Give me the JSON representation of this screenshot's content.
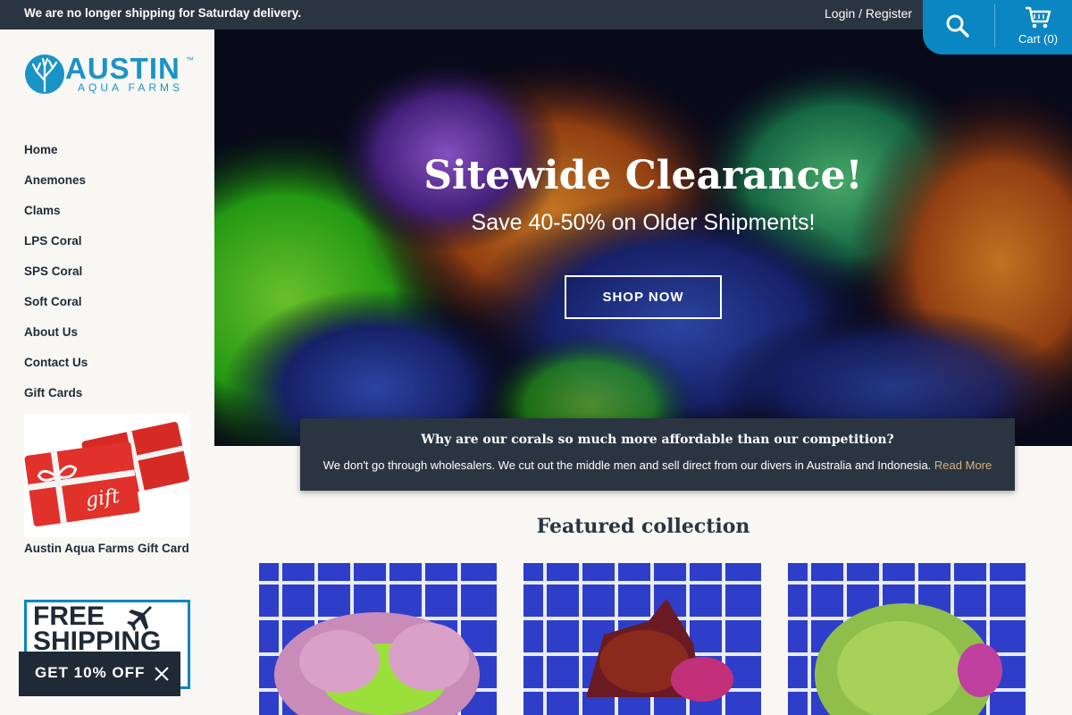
{
  "announcement": "We are no longer shipping for Saturday delivery.",
  "header": {
    "login_label": "Login / Register",
    "cart_label": "Cart (0)",
    "search_icon": "search-icon",
    "cart_icon": "cart-icon"
  },
  "logo": {
    "name": "AUSTIN",
    "subtitle": "AQUA FARMS",
    "tm": "™"
  },
  "nav": {
    "items": [
      "Home",
      "Anemones",
      "Clams",
      "LPS Coral",
      "SPS Coral",
      "Soft Coral",
      "About Us",
      "Contact Us",
      "Gift Cards"
    ]
  },
  "gift_card": {
    "caption": "Austin Aqua Farms Gift Card",
    "image_text": "gift card"
  },
  "free_shipping": {
    "line1": "FREE",
    "line2": "SHIPPING"
  },
  "promo": {
    "label": "GET 10% OFF"
  },
  "hero": {
    "headline": "Sitewide Clearance!",
    "subline": "Save 40-50% on Older Shipments!",
    "cta": "SHOP NOW"
  },
  "callout": {
    "question": "Why are our corals so much more affordable than our competition?",
    "answer": "We don't go through wholesalers. We cut out the middle men and sell direct from our divers in Australia and Indonesia.",
    "link": "Read More"
  },
  "featured": {
    "title": "Featured collection"
  },
  "colors": {
    "brand": "#0a86c3",
    "dark": "#2b3542",
    "link": "#d9b07a"
  }
}
